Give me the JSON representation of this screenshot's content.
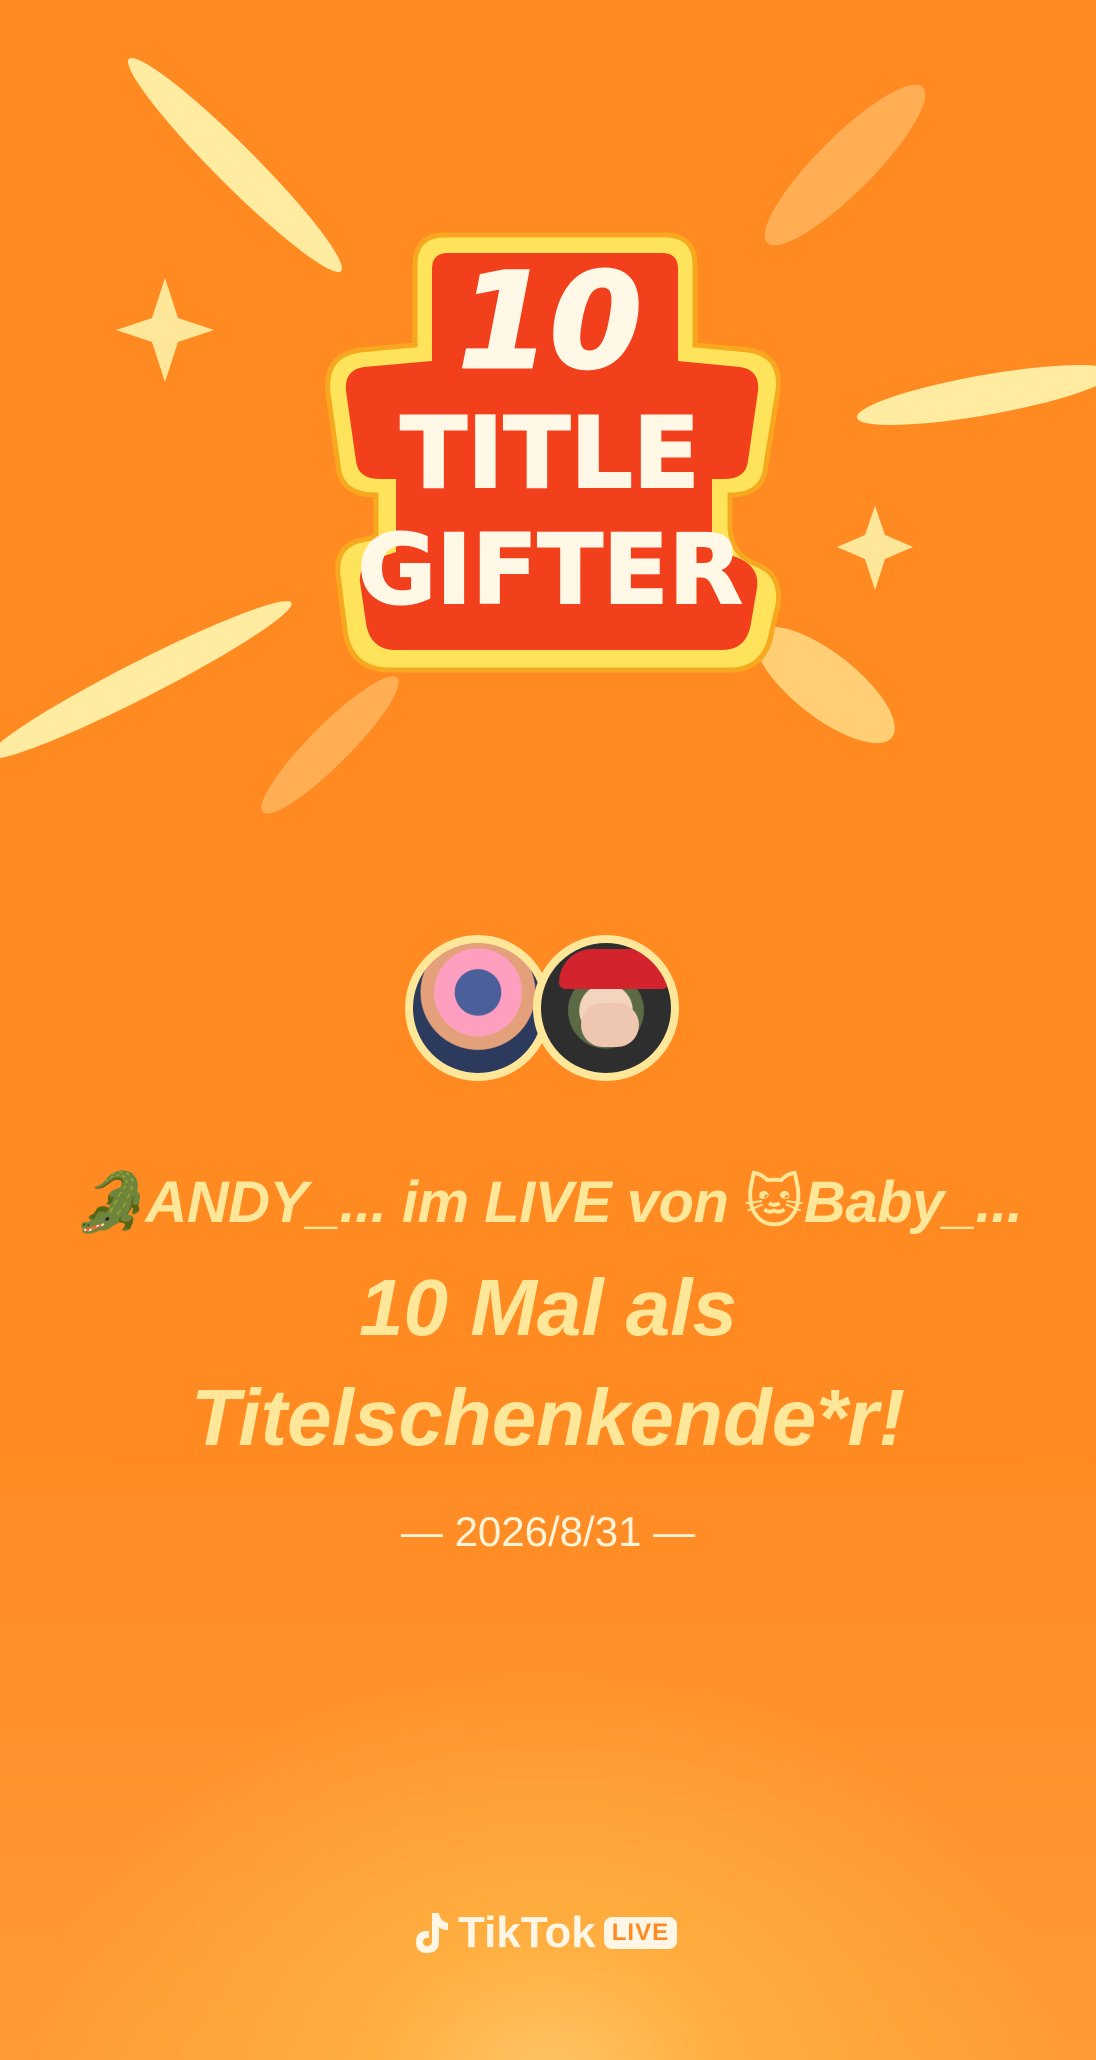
{
  "badge": {
    "number": "10",
    "title_line1": "TITLE",
    "title_line2": "GIFTER"
  },
  "users": {
    "gifter": "🐊ANDY_...",
    "host": "🐱Baby_..."
  },
  "text": {
    "line1_prefix": " im LIVE von ",
    "line2": "10 Mal als",
    "line3": "Titelschenkende*r!"
  },
  "date": "— 2026/8/31 —",
  "footer": {
    "brand": "TikTok",
    "live_label": "LIVE"
  },
  "colors": {
    "background": "#ff8a22",
    "accent_text": "#ffe79a",
    "badge_red": "#f2401d",
    "badge_border": "#ffd85a"
  }
}
